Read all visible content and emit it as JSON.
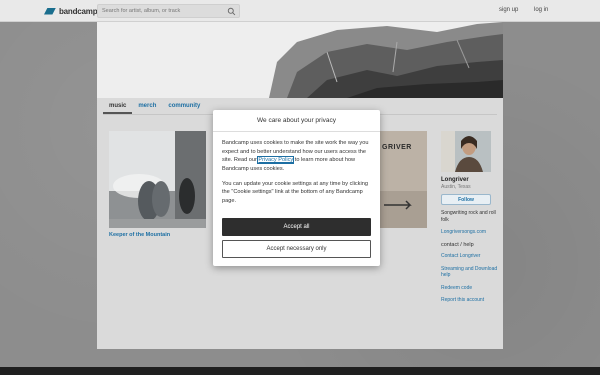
{
  "header": {
    "logo_text": "bandcamp",
    "search_placeholder": "Search for artist, album, or track",
    "signup_label": "sign up",
    "login_label": "log in"
  },
  "nav": {
    "tabs": [
      {
        "label": "music",
        "active": true
      },
      {
        "label": "merch",
        "active": false
      },
      {
        "label": "community",
        "active": false
      }
    ]
  },
  "album": {
    "title": "Keeper of the Mountain",
    "second_cover_text": "GRIVER"
  },
  "artist": {
    "name": "Longriver",
    "location": "Austin, Texas",
    "follow_label": "Follow",
    "bio": "Songwriting rock and roll folk",
    "website": "Longriversongs.com",
    "contact_heading": "contact / help",
    "links": [
      "Contact Longriver",
      "Streaming and Download help",
      "Redeem code",
      "Report this account"
    ]
  },
  "cookie_modal": {
    "title": "We care about your privacy",
    "para1_before": "Bandcamp uses cookies to make the site work the way you expect and to better understand how our users access the site. Read our ",
    "privacy_link": "Privacy Policy",
    "para1_after": " to learn more about how Bandcamp uses cookies.",
    "para2": "You can update your cookie settings at any time by clicking the \"Cookie settings\" link at the bottom of any Bandcamp page.",
    "accept_all_label": "Accept all",
    "accept_necessary_label": "Accept necessary only"
  },
  "colors": {
    "link": "#1d6fa3",
    "accept_button": "#2e2e2e",
    "logo_accent": "#1a6e8e"
  }
}
